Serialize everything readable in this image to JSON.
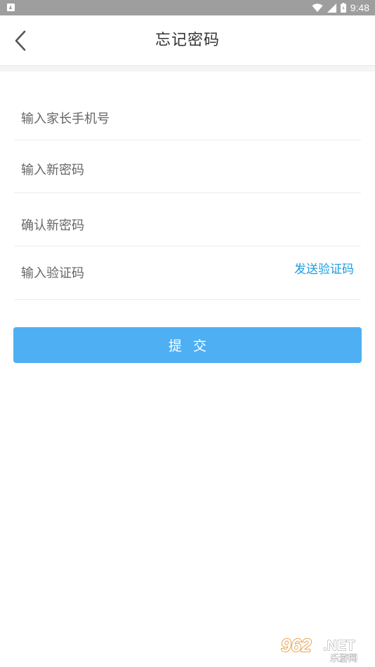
{
  "status_bar": {
    "time": "9:48",
    "icons": [
      "app-notification-icon",
      "wifi-icon",
      "signal-icon",
      "battery-icon"
    ]
  },
  "header": {
    "title": "忘记密码",
    "back_icon": "chevron-left-icon"
  },
  "form": {
    "phone_placeholder": "输入家长手机号",
    "new_password_placeholder": "输入新密码",
    "confirm_password_placeholder": "确认新密码",
    "code_placeholder": "输入验证码",
    "send_code_label": "发送验证码"
  },
  "submit": {
    "label": "提交"
  },
  "watermark": {
    "brand_number": "962",
    "brand_suffix": ".NET",
    "brand_cn": "乐游网"
  },
  "colors": {
    "accent": "#1e9ce0",
    "button": "#4eb0f3",
    "status_bar": "#9e9e9e"
  }
}
